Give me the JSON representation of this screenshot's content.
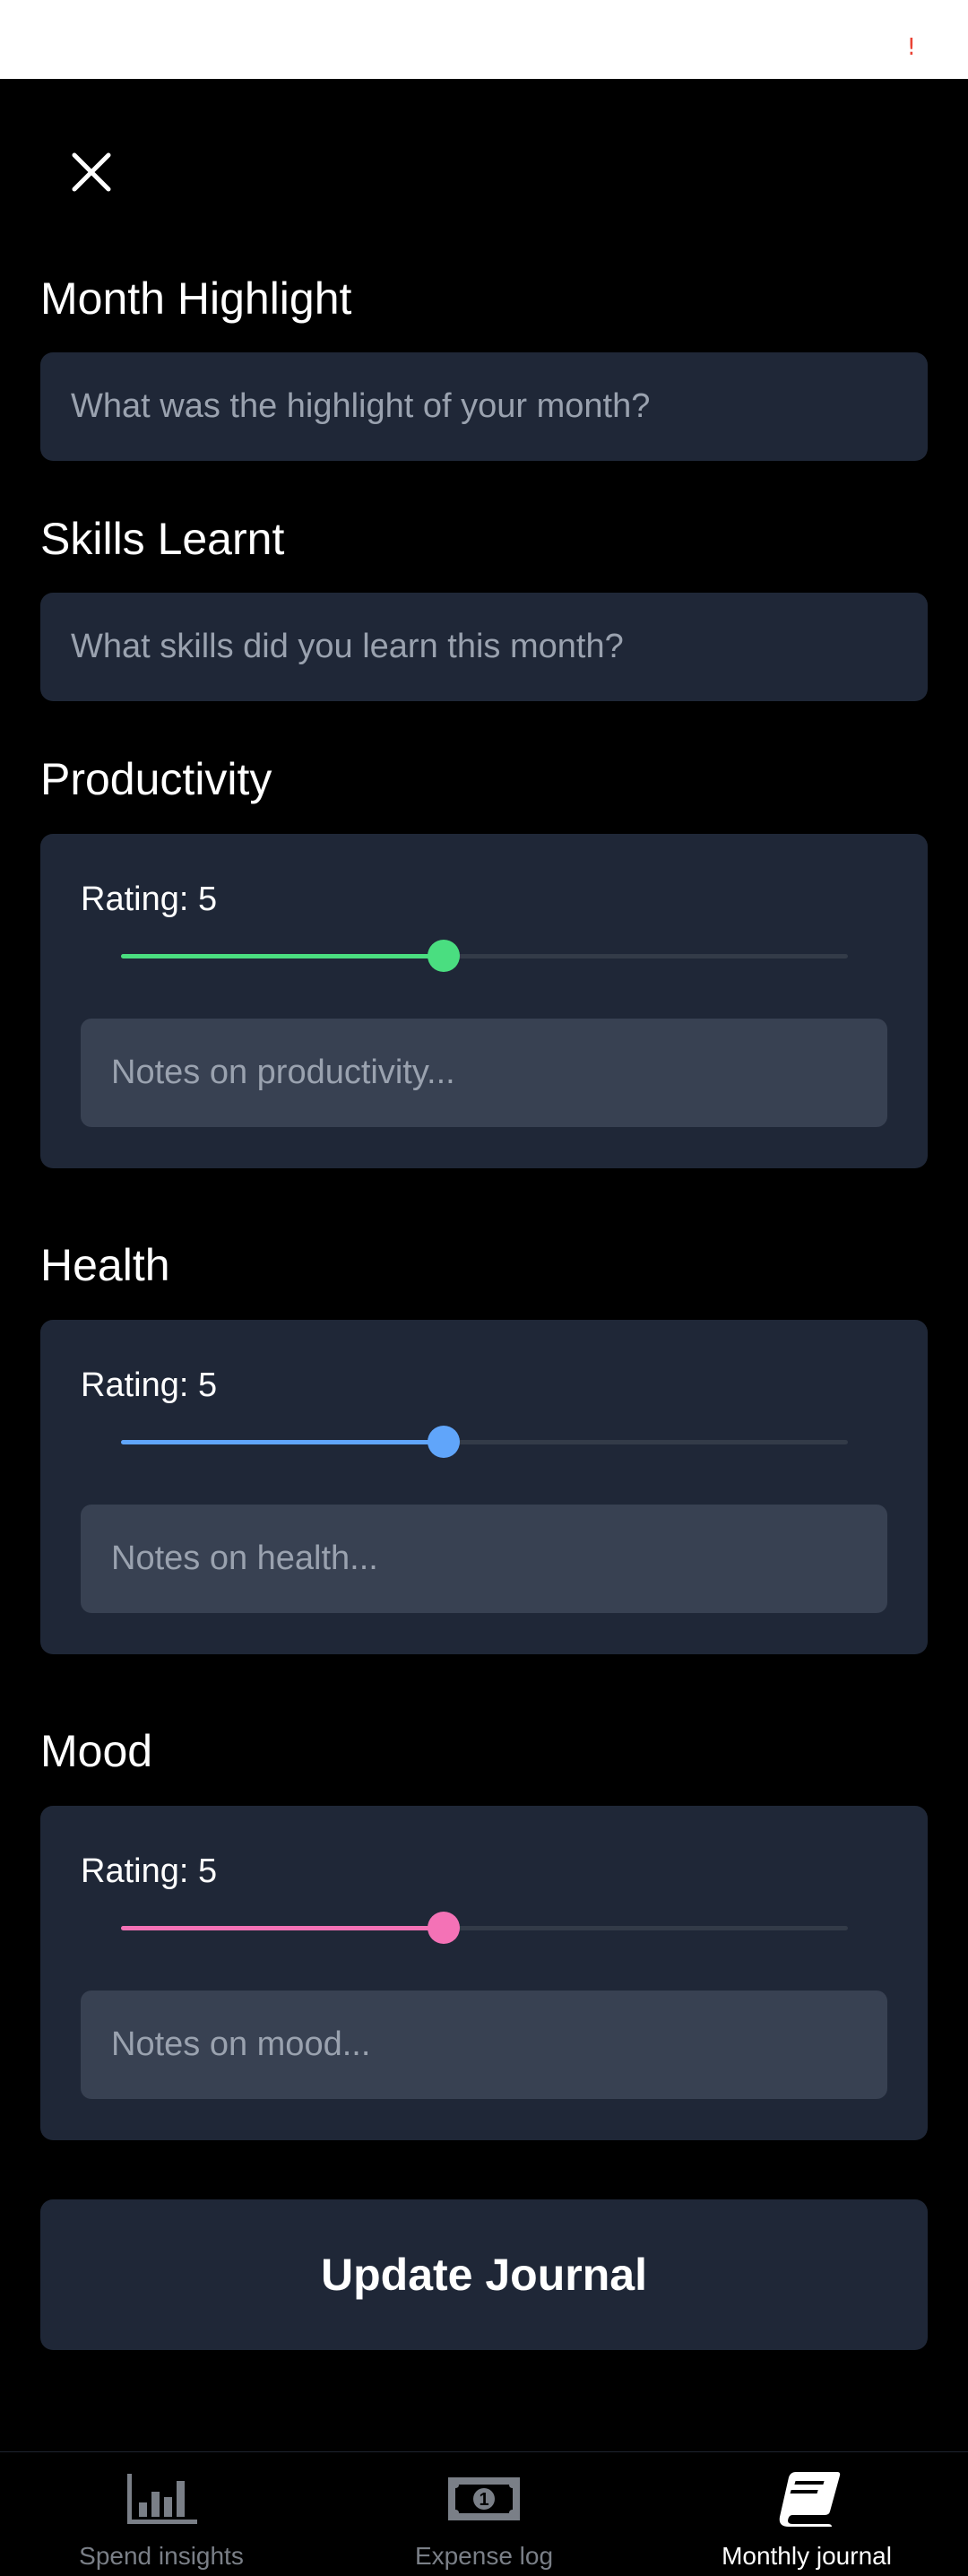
{
  "status_bar": {
    "alert": "!"
  },
  "sections": {
    "highlight": {
      "title": "Month Highlight",
      "placeholder": "What was the highlight of your month?"
    },
    "skills": {
      "title": "Skills Learnt",
      "placeholder": "What skills did you learn this month?"
    },
    "productivity": {
      "title": "Productivity",
      "rating_label": "Rating: 5",
      "rating": 5,
      "notes_placeholder": "Notes on productivity...",
      "color": "#4ade80"
    },
    "health": {
      "title": "Health",
      "rating_label": "Rating: 5",
      "rating": 5,
      "notes_placeholder": "Notes on health...",
      "color": "#60a5fa"
    },
    "mood": {
      "title": "Mood",
      "rating_label": "Rating: 5",
      "rating": 5,
      "notes_placeholder": "Notes on mood...",
      "color": "#f472b6"
    }
  },
  "update_button": "Update Journal",
  "nav": [
    {
      "label": "Spend insights",
      "icon": "bar-chart-icon",
      "active": false
    },
    {
      "label": "Expense log",
      "icon": "money-icon",
      "active": false
    },
    {
      "label": "Monthly journal",
      "icon": "book-icon",
      "active": true
    }
  ],
  "colors": {
    "background": "#000000",
    "card": "#1f2737",
    "input": "#384152",
    "inactive_nav": "#7a7f87",
    "active_nav": "#ffffff"
  }
}
